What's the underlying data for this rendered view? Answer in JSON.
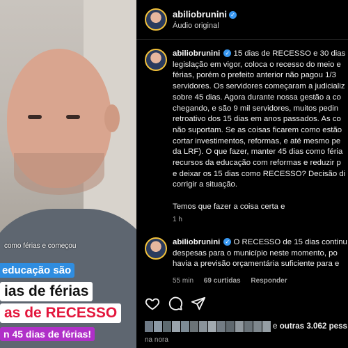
{
  "video": {
    "caption_small": "como férias e começou",
    "chips": [
      "educação são",
      "ias de férias",
      "as de RECESSO",
      "n 45 dias de férias!"
    ]
  },
  "post_header": {
    "username": "abiliobrunini",
    "audio": "Áudio original"
  },
  "main_comment": {
    "username": "abiliobrunini",
    "lines": [
      "15 dias de RECESSO e 30 dias c",
      "legislação em vigor, coloca o recesso do meio e",
      "férias, porém o prefeito anterior não pagou 1/3",
      "servidores. Os servidores começaram a judicializ",
      "sobre 45 dias. Agora durante nossa gestão a co",
      "chegando, e são 9 mil servidores, muitos pedin",
      "retroativo dos 15 dias em anos passados. As co",
      "não suportam. Se as coisas ficarem como estão",
      "cortar investimentos, reformas, e até mesmo pe",
      "da LRF). O que fazer, manter 45 dias como féria",
      "recursos da educação com reformas e reduzir p",
      "e deixar os 15 dias como RECESSO? Decisão di",
      "corrigir a situação."
    ],
    "extra": "Temos que fazer a coisa certa e",
    "time": "1 h"
  },
  "reply_comment": {
    "username": "abiliobrunini",
    "lines": [
      "O RECESSO de 15 dias continu",
      "despesas para o município neste momento, po",
      "havia a previsão orçamentária suficiente para e"
    ],
    "time": "55 min",
    "likes": "69 curtidas",
    "reply": "Responder"
  },
  "likes_line": {
    "prefix": "e",
    "bold": "outras 3.062 pess"
  },
  "date": "na   nora",
  "icons": [
    "heart-icon",
    "comment-icon",
    "share-icon"
  ],
  "colors": {
    "verified": "#3897f0",
    "avatar_ring": "#f3c23b",
    "recesso": "#e3163c",
    "chip_blue": "#2f8de0",
    "chip_purple": "#b030c8"
  }
}
